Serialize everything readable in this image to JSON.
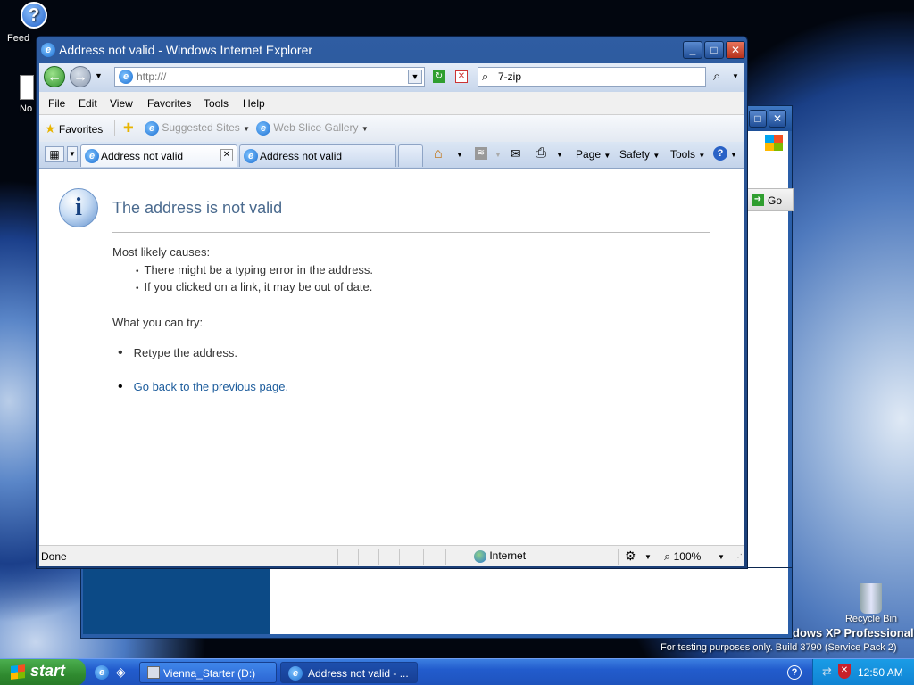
{
  "desktop": {
    "icons": [
      {
        "label": "Feed",
        "icon": "help-icon"
      },
      {
        "label": "No",
        "icon": "document-icon"
      }
    ],
    "recycle_bin": "Recycle Bin",
    "watermark": {
      "line1": "dows XP Professional",
      "line2": "For testing purposes only. Build 3790 (Service Pack 2)"
    },
    "background_window": {
      "go_label": "Go"
    }
  },
  "window": {
    "title": "Address not valid - Windows Internet Explorer",
    "controls": {
      "minimize": "minimize-icon",
      "maximize": "maximize-icon",
      "close": "close-icon"
    }
  },
  "navbar": {
    "address_placeholder": "http:///",
    "search_value": "7-zip"
  },
  "menu": [
    "File",
    "Edit",
    "View",
    "Favorites",
    "Tools",
    "Help"
  ],
  "favorites_bar": {
    "favorites": "Favorites",
    "suggested_sites": "Suggested Sites",
    "web_slice_gallery": "Web Slice Gallery"
  },
  "tabs": [
    {
      "label": "Address not valid",
      "active": true
    },
    {
      "label": "Address not valid",
      "active": false
    }
  ],
  "command_bar": {
    "page": "Page",
    "safety": "Safety",
    "tools": "Tools"
  },
  "page": {
    "heading": "The address is not valid",
    "causes_title": "Most likely causes:",
    "causes": [
      "There might be a typing error in the address.",
      "If you clicked on a link, it may be out of date."
    ],
    "try_title": "What you can try:",
    "retype": "Retype the address.",
    "go_back_link": "Go back to the previous page."
  },
  "status": {
    "text": "Done",
    "zone": "Internet",
    "zoom": "100%"
  },
  "taskbar": {
    "start": "start",
    "tasks": [
      {
        "label": "Vienna_Starter (D:)"
      },
      {
        "label": "Address not valid - ..."
      }
    ],
    "clock": "12:50 AM"
  },
  "colors": {
    "link": "#1c5c9c",
    "heading": "#4a6a8e",
    "taskbar": "#245edb",
    "start": "#3a9a3a"
  }
}
